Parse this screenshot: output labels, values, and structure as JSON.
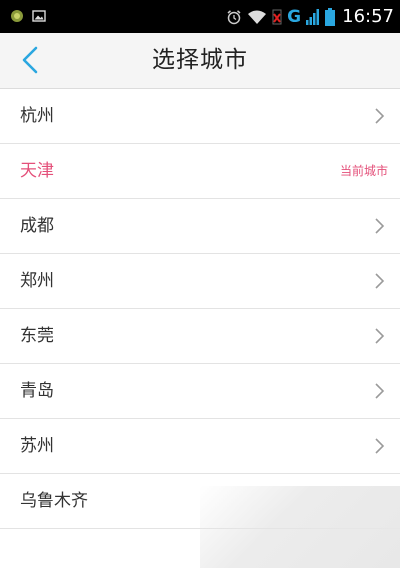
{
  "status_bar": {
    "network": "G",
    "time": "16:57"
  },
  "header": {
    "back_icon": "chevron-left-icon",
    "title": "选择城市"
  },
  "cities": [
    {
      "name": "杭州",
      "current": false
    },
    {
      "name": "天津",
      "current": true,
      "note": "当前城市"
    },
    {
      "name": "成都",
      "current": false
    },
    {
      "name": "郑州",
      "current": false
    },
    {
      "name": "东莞",
      "current": false
    },
    {
      "name": "青岛",
      "current": false
    },
    {
      "name": "苏州",
      "current": false
    },
    {
      "name": "乌鲁木齐",
      "current": false
    }
  ],
  "colors": {
    "accent_blue": "#2aa7e0",
    "current_city_pink": "#e4507a",
    "header_bg": "#f5f5f5"
  }
}
